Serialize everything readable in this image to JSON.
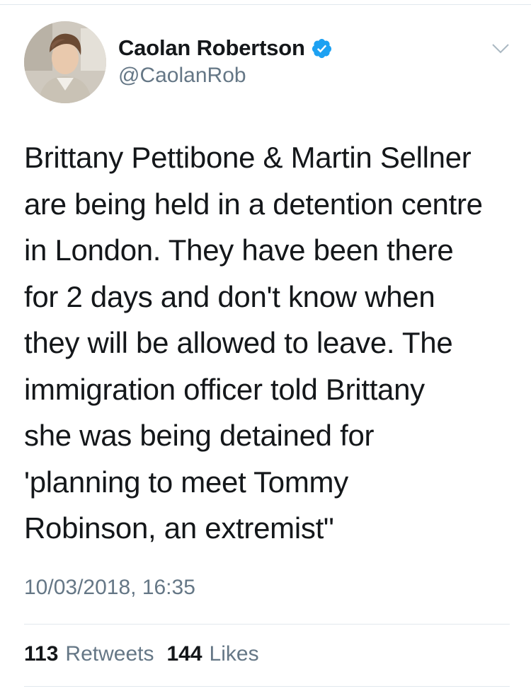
{
  "author": {
    "display_name": "Caolan Robertson",
    "handle": "@CaolanRob",
    "verified": true
  },
  "tweet": {
    "text": "Brittany Pettibone & Martin Sellner\nare being held in a detention centre\nin London. They have been there\nfor 2 days and don't know when\nthey will be allowed to leave. The\nimmigration officer told Brittany\nshe was being detained for\n'planning to meet Tommy\nRobinson, an extremist\"",
    "timestamp": "10/03/2018, 16:35"
  },
  "stats": {
    "retweets_count": "113",
    "retweets_label": "Retweets",
    "likes_count": "144",
    "likes_label": "Likes"
  },
  "icons": {
    "verified": "verified-badge-icon",
    "caret": "chevron-down-icon"
  },
  "colors": {
    "primary_text": "#14171a",
    "secondary_text": "#657786",
    "verified_blue": "#1da1f2",
    "divider": "#e1e8ed"
  }
}
